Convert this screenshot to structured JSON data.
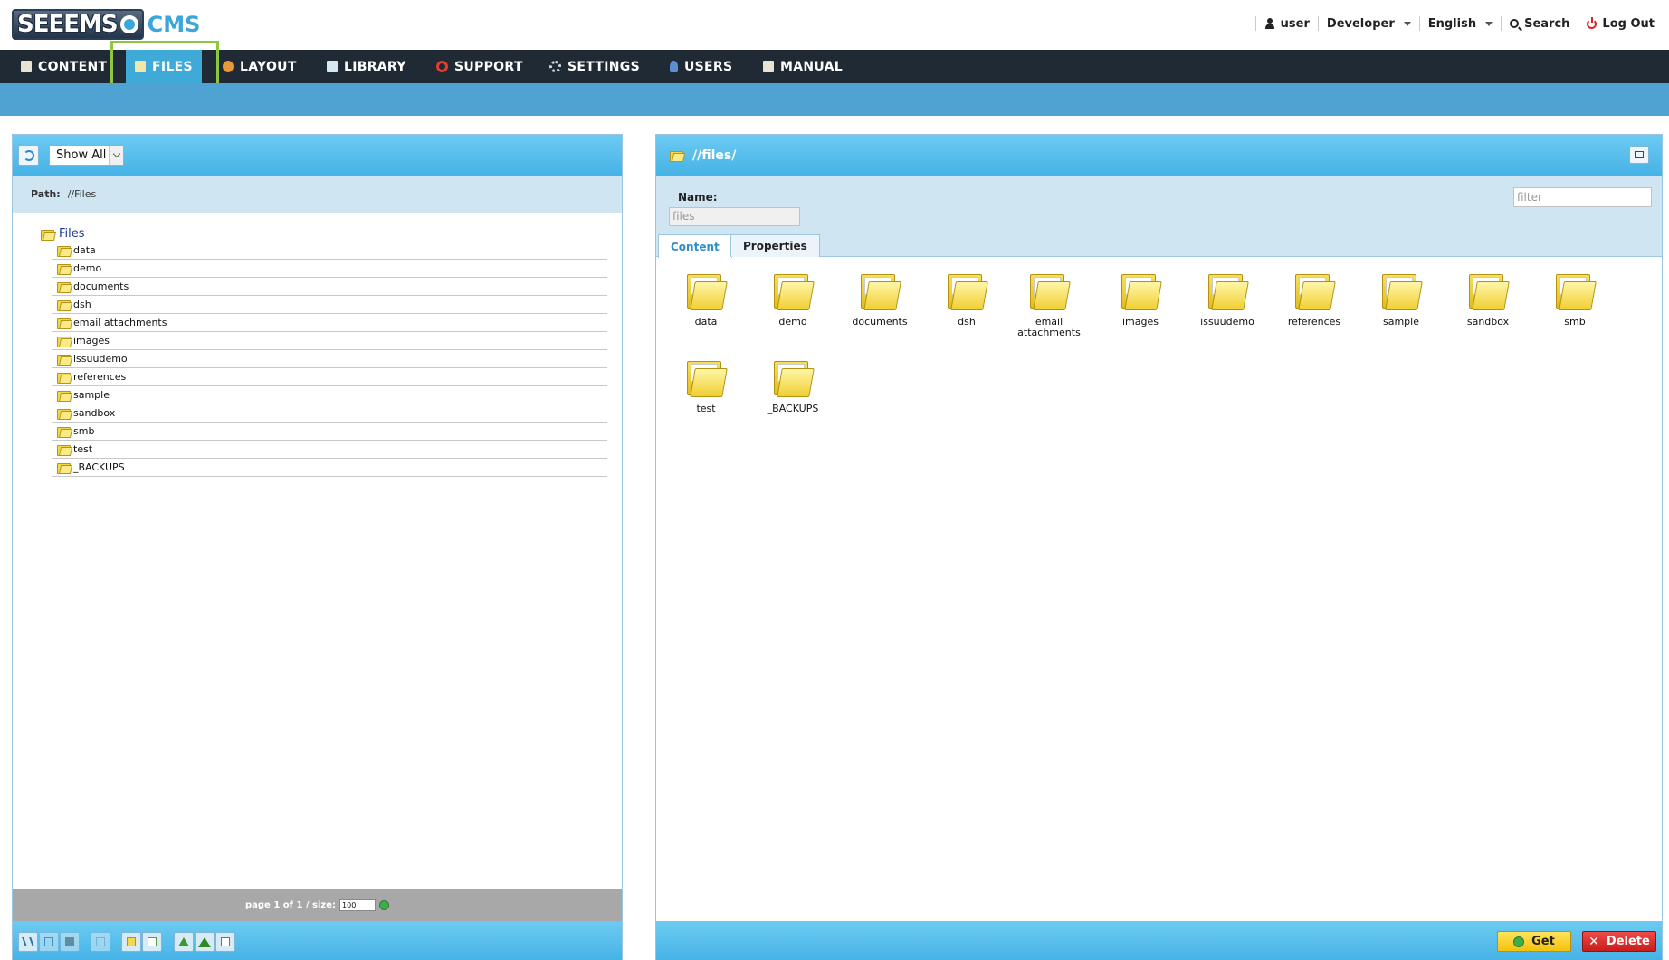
{
  "logo": {
    "brand": "SEEEMS",
    "suffix": "CMS"
  },
  "topbar": {
    "user": "user",
    "role": "Developer",
    "language": "English",
    "search": "Search",
    "logout": "Log Out"
  },
  "nav": {
    "items": [
      {
        "label": "CONTENT",
        "icon": "page-icon"
      },
      {
        "label": "FILES",
        "icon": "files-icon",
        "active": true
      },
      {
        "label": "LAYOUT",
        "icon": "palette-icon"
      },
      {
        "label": "LIBRARY",
        "icon": "book-icon"
      },
      {
        "label": "SUPPORT",
        "icon": "lifebuoy-icon"
      },
      {
        "label": "SETTINGS",
        "icon": "gear-icon"
      },
      {
        "label": "USERS",
        "icon": "user-icon"
      },
      {
        "label": "MANUAL",
        "icon": "manual-icon"
      }
    ]
  },
  "left": {
    "filter": "Show All",
    "path_label": "Path:",
    "path_value": "//Files",
    "tree_root": "Files",
    "tree_items": [
      "data",
      "demo",
      "documents",
      "dsh",
      "email attachments",
      "images",
      "issuudemo",
      "references",
      "sample",
      "sandbox",
      "smb",
      "test",
      "_BACKUPS"
    ],
    "pager_text": "page 1 of 1 / size:",
    "page_size": "100"
  },
  "right": {
    "header_path": "//files/",
    "name_label": "Name:",
    "name_value": "files",
    "filter_placeholder": "filter",
    "tabs": [
      "Content",
      "Properties"
    ],
    "folders": [
      "data",
      "demo",
      "documents",
      "dsh",
      "email attachments",
      "images",
      "issuudemo",
      "references",
      "sample",
      "sandbox",
      "smb",
      "test",
      "_BACKUPS"
    ],
    "get_label": "Get",
    "delete_label": "Delete"
  },
  "colors": {
    "nav_bg": "#1f2a34",
    "accent": "#3fa9d8",
    "highlight": "#8dc63f",
    "panel_header": "#45b2e6",
    "info_bg": "#cfe6f2"
  }
}
